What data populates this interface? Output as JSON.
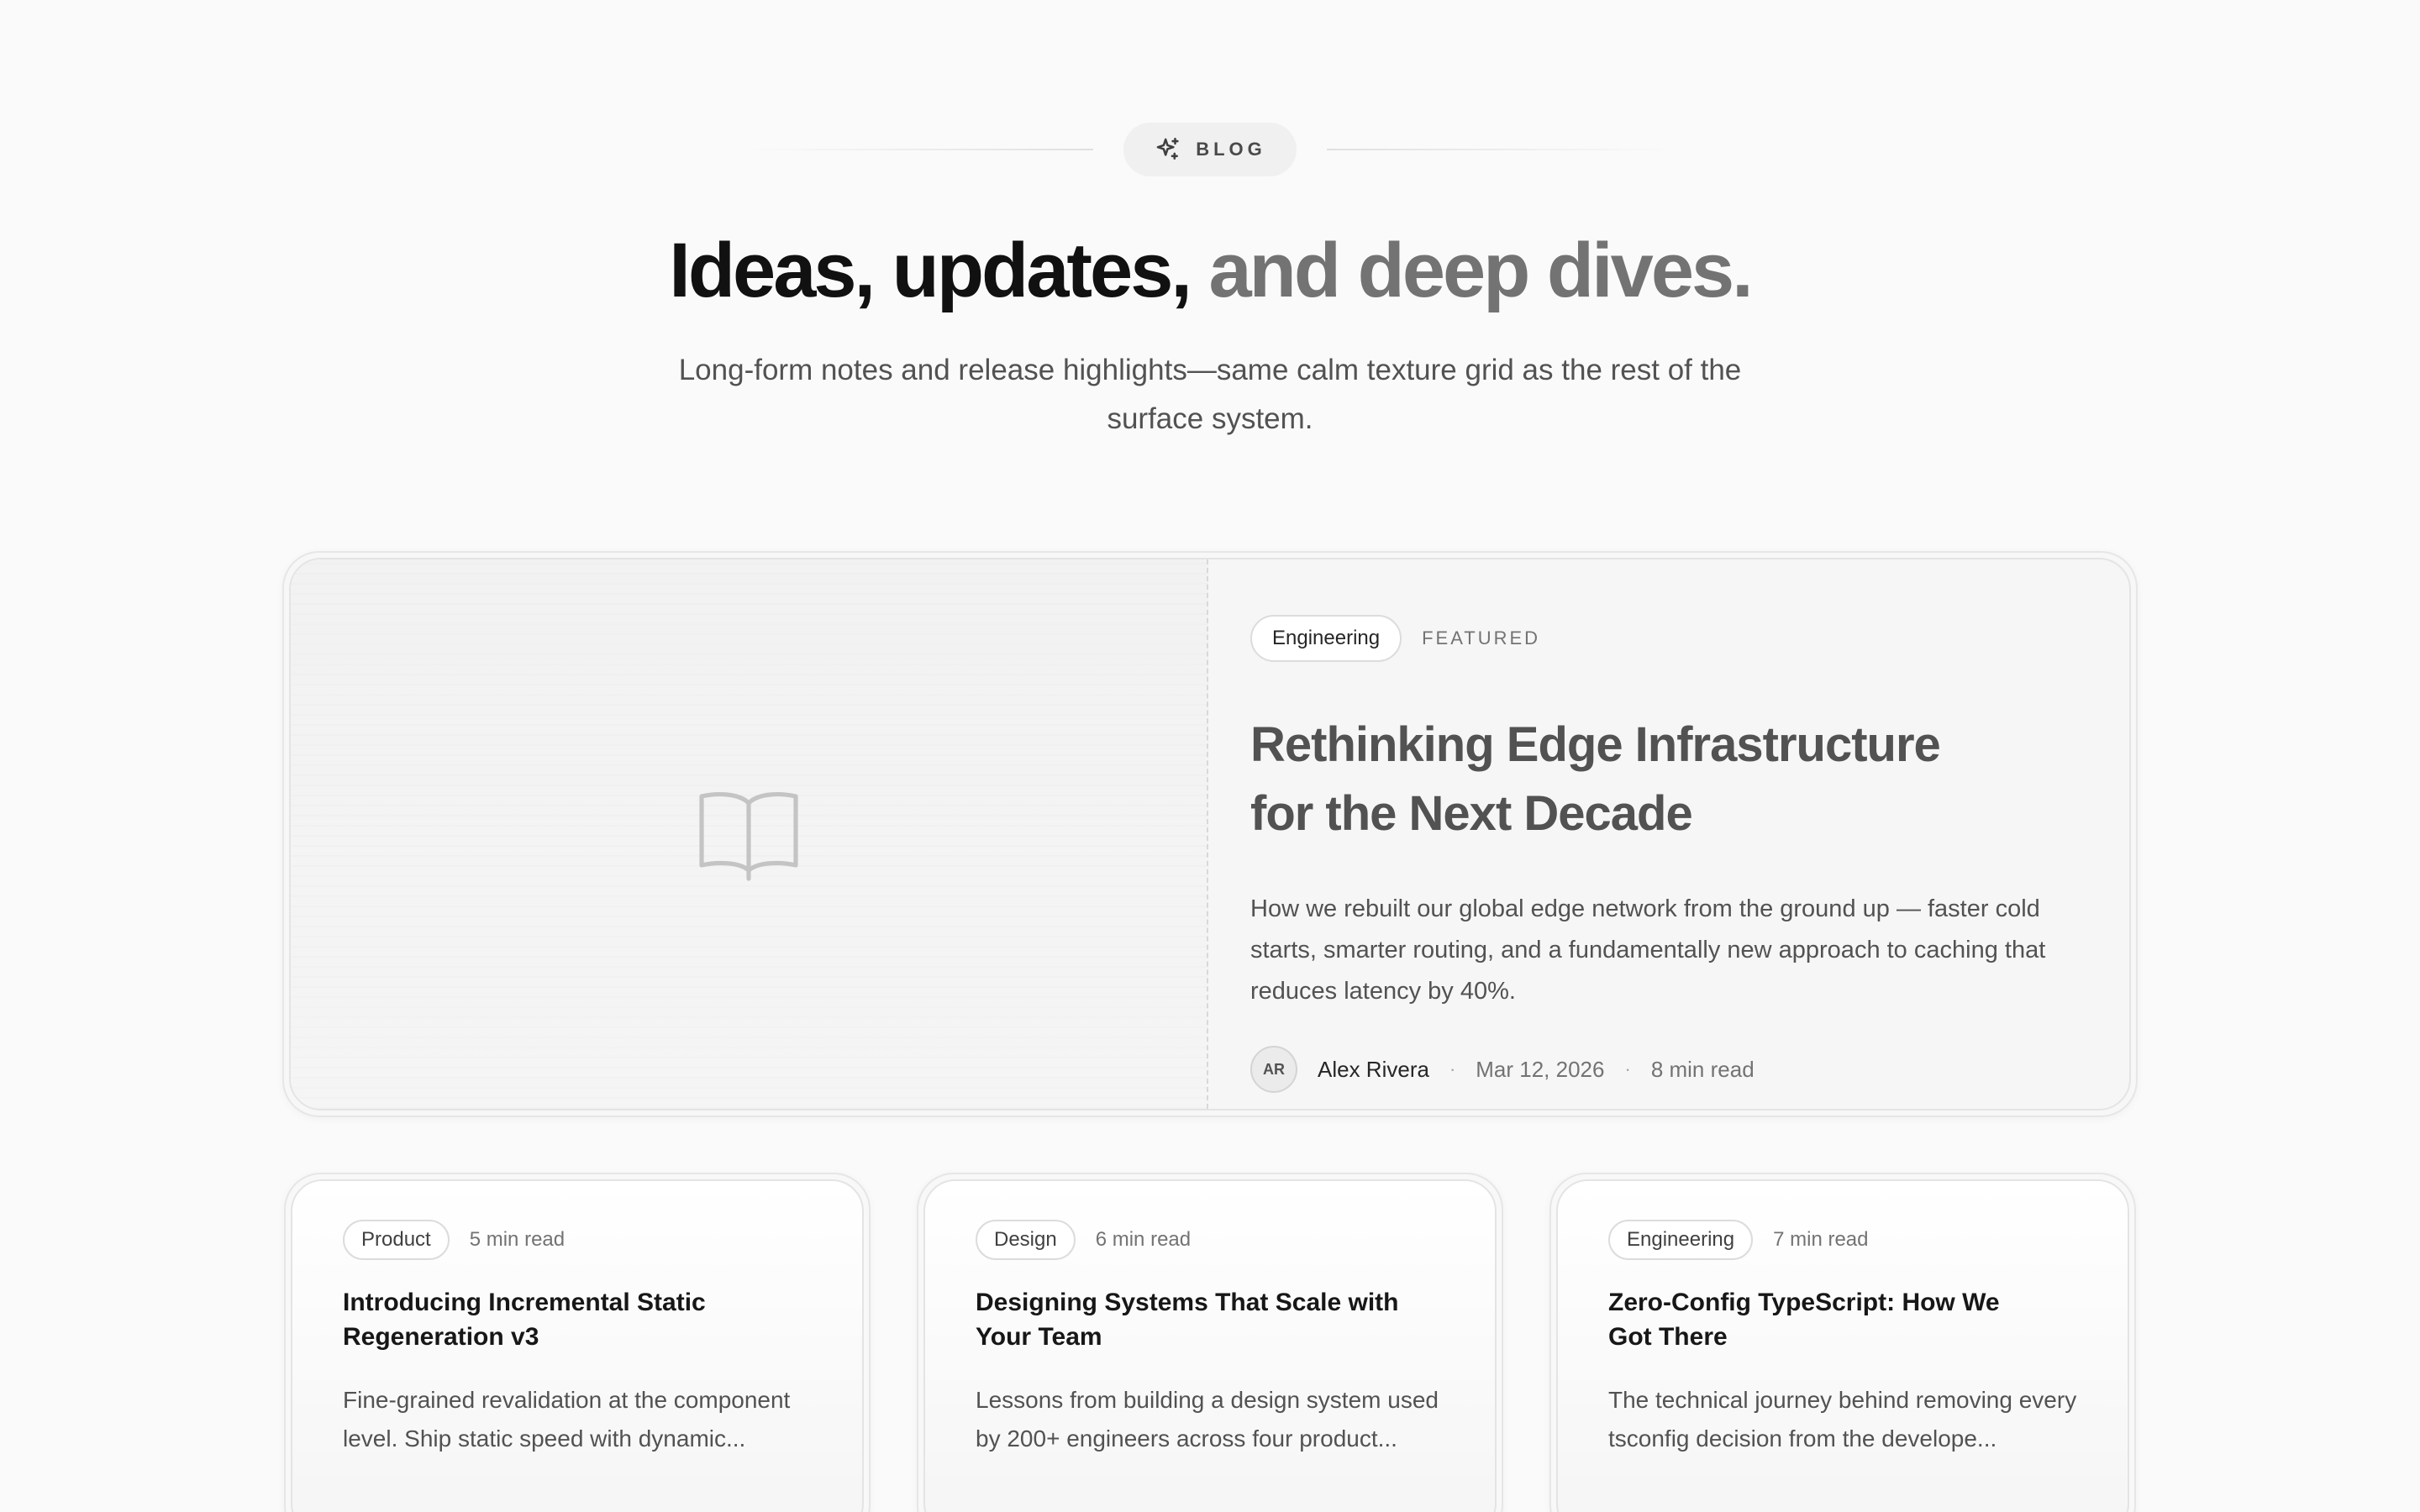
{
  "header": {
    "eyebrow": {
      "icon": "sparkles-icon",
      "label": "BLOG"
    },
    "headline_dark": "Ideas, updates,",
    "headline_light": "and deep dives.",
    "subtitle": "Long-form notes and release highlights—same calm texture grid as the rest of the surface system."
  },
  "featured": {
    "media_icon": "book-open-icon",
    "category": "Engineering",
    "label": "FEATURED",
    "title": "Rethinking Edge Infrastructure for the Next Decade",
    "excerpt": "How we rebuilt our global edge network from the ground up — faster cold starts, smarter routing, and a fundamentally new approach to caching that reduces latency by 40%.",
    "author_initials": "AR",
    "author": "Alex Rivera",
    "separator": "·",
    "date": "Mar 12, 2026",
    "read_time": "8 min read"
  },
  "posts": [
    {
      "category": "Product",
      "read_time": "5 min read",
      "title": "Introducing Incremental Static Regeneration v3",
      "excerpt": "Fine-grained revalidation at the component level. Ship static speed with dynamic..."
    },
    {
      "category": "Design",
      "read_time": "6 min read",
      "title": "Designing Systems That Scale with Your Team",
      "excerpt": "Lessons from building a design system used by 200+ engineers across four product..."
    },
    {
      "category": "Engineering",
      "read_time": "7 min read",
      "title": "Zero-Config TypeScript: How We Got There",
      "excerpt": "The technical journey behind removing every tsconfig decision from the develope..."
    }
  ]
}
